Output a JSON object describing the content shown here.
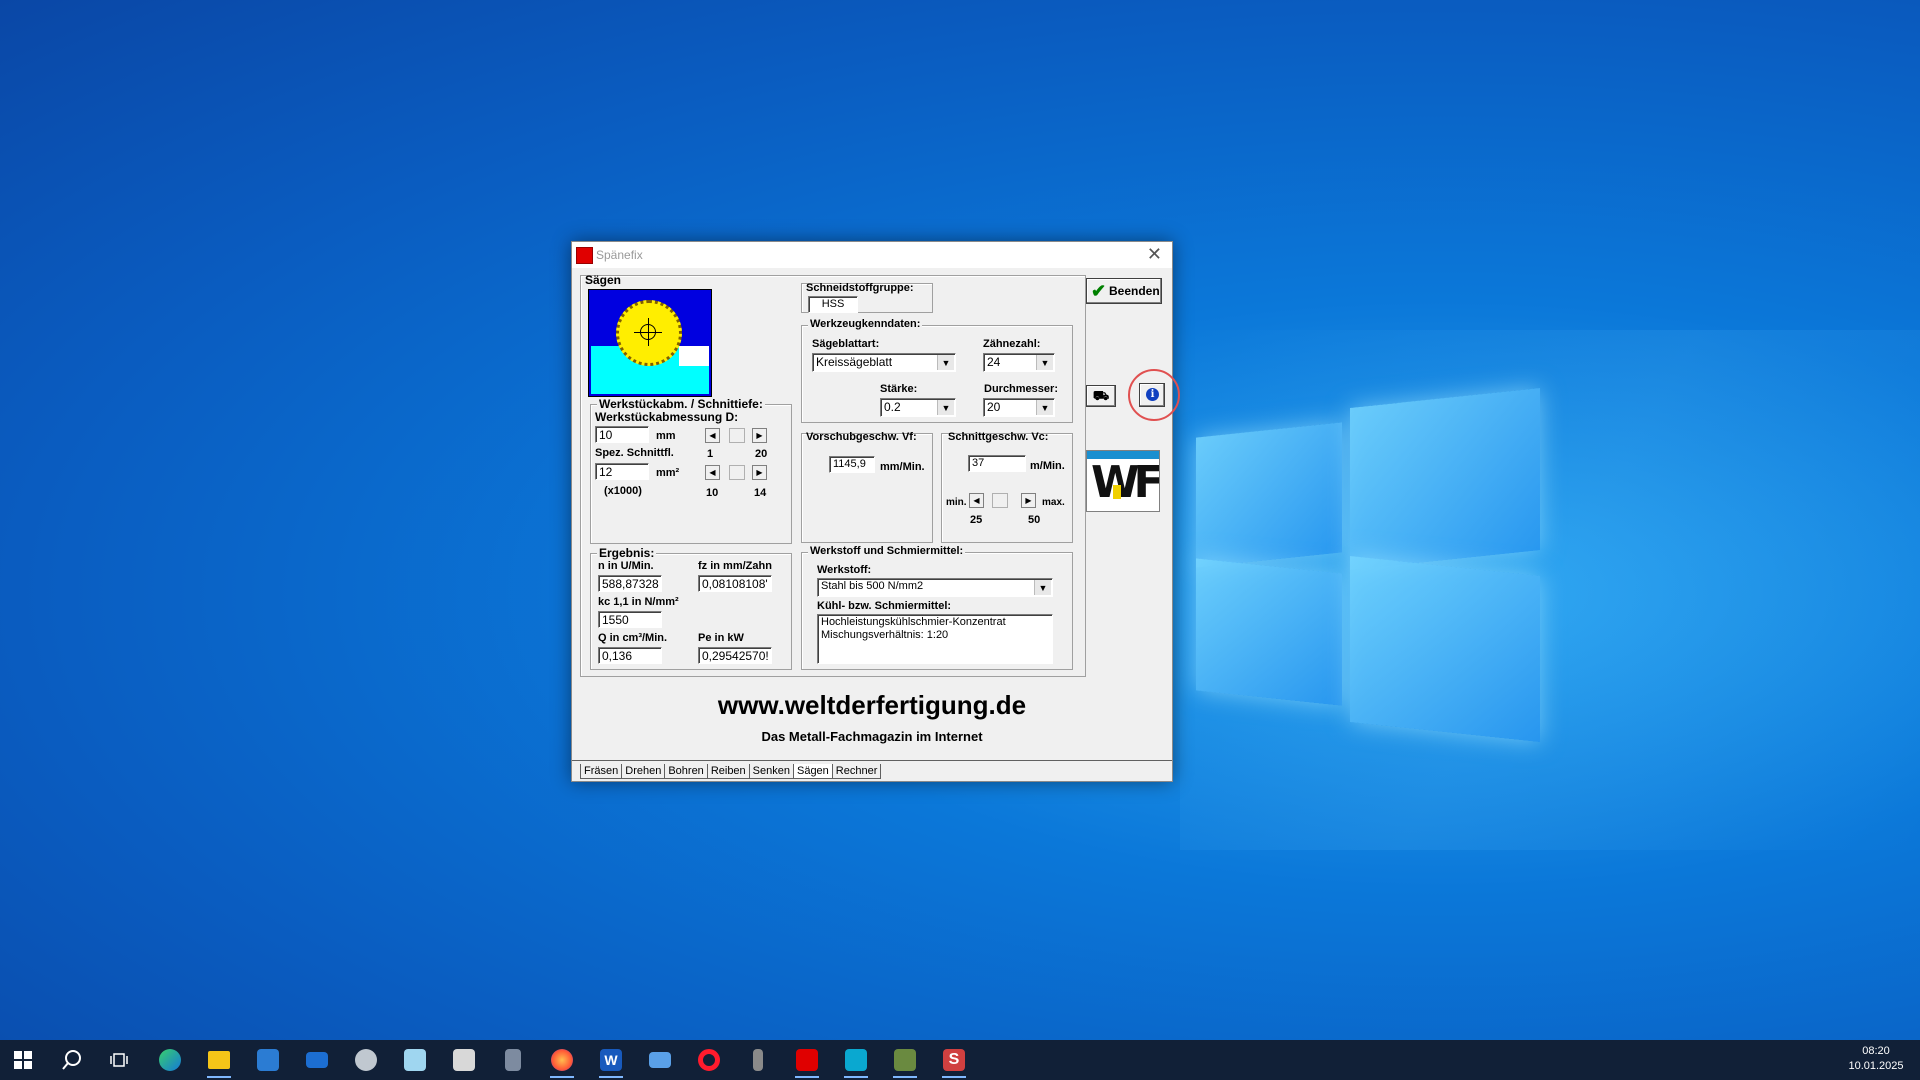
{
  "window": {
    "title": "Spänefix",
    "close_glyph": "✕"
  },
  "saegen": {
    "group_label": "Sägen",
    "illustration": "circular-saw-blade-cutting-workpiece"
  },
  "werkstueck": {
    "group_label": "Werkstückabm. / Schnittiefe:",
    "dim_label": "Werkstückabmessung D:",
    "dim_value": "10",
    "dim_unit": "mm",
    "dim_min": "1",
    "dim_max": "20",
    "spez_label": "Spez. Schnittfl.",
    "spez_value": "12",
    "spez_unit": "mm²",
    "spez_factor": "(x1000)",
    "spez_min": "10",
    "spez_max": "14"
  },
  "schneidstoff": {
    "group_label": "Schneidstoffgruppe:",
    "value": "HSS"
  },
  "werkzeug": {
    "group_label": "Werkzeugkenndaten:",
    "saegeblattart_label": "Sägeblattart:",
    "saegeblattart_value": "Kreissägeblatt",
    "zaehnezahl_label": "Zähnezahl:",
    "zaehnezahl_value": "24",
    "staerke_label": "Stärke:",
    "staerke_value": "0.2",
    "durchmesser_label": "Durchmesser:",
    "durchmesser_value": "20"
  },
  "vorschub": {
    "group_label": "Vorschubgeschw. Vf:",
    "value": "1145,9",
    "unit": "mm/Min."
  },
  "schnitt": {
    "group_label": "Schnittgeschw. Vc:",
    "value": "37",
    "unit": "m/Min.",
    "min_label": "min.",
    "max_label": "max.",
    "min_value": "25",
    "max_value": "50"
  },
  "ergebnis": {
    "group_label": "Ergebnis:",
    "n_label": "n in U/Min.",
    "n_value": "588,87328",
    "fz_label": "fz in mm/Zahn",
    "fz_value": "0,08108108'",
    "kc_label": "kc 1,1 in N/mm²",
    "kc_value": "1550",
    "q_label": "Q in cm³/Min.",
    "q_value": "0,136",
    "pe_label": "Pe in kW",
    "pe_value": "0,29542570!"
  },
  "werkstoff": {
    "group_label": "Werkstoff und Schmiermittel:",
    "werkstoff_label": "Werkstoff:",
    "werkstoff_value": "Stahl bis 500 N/mm2",
    "kuehl_label": "Kühl- bzw. Schmiermittel:",
    "kuehl_line1": "Hochleistungskühlschmier-Konzentrat",
    "kuehl_line2": "Mischungsverhältnis: 1:20"
  },
  "buttons": {
    "beenden": "Beenden",
    "beenden_icon": "checkmark-icon",
    "car_icon": "car-icon",
    "info_icon": "info-icon"
  },
  "brand": {
    "logo_text": "WF",
    "url": "www.weltderfertigung.de",
    "tagline": "Das Metall-Fachmagazin im Internet"
  },
  "tabs": [
    "Fräsen",
    "Drehen",
    "Bohren",
    "Reiben",
    "Senken",
    "Sägen",
    "Rechner"
  ],
  "active_tab": "Sägen",
  "taskbar": {
    "icons": [
      "start-icon",
      "search-icon",
      "task-view-icon",
      "edge-icon",
      "file-explorer-icon",
      "store-icon",
      "mail-icon",
      "paint-icon",
      "notepad-icon",
      "printer-icon",
      "calculator-icon",
      "firefox-icon",
      "word-icon",
      "folder-icon",
      "opera-icon",
      "usb-icon",
      "red-app-icon",
      "camera-icon",
      "photo-icon",
      "red-s-app-icon"
    ],
    "time": "08:20",
    "date": "10.01.2025"
  },
  "colors": {
    "desktop": "#0b78d9",
    "highlight_ring": "#e05050",
    "saw_blade": "#ffee00",
    "saw_bg": "#0000e0",
    "workpiece": "#00ffff"
  }
}
